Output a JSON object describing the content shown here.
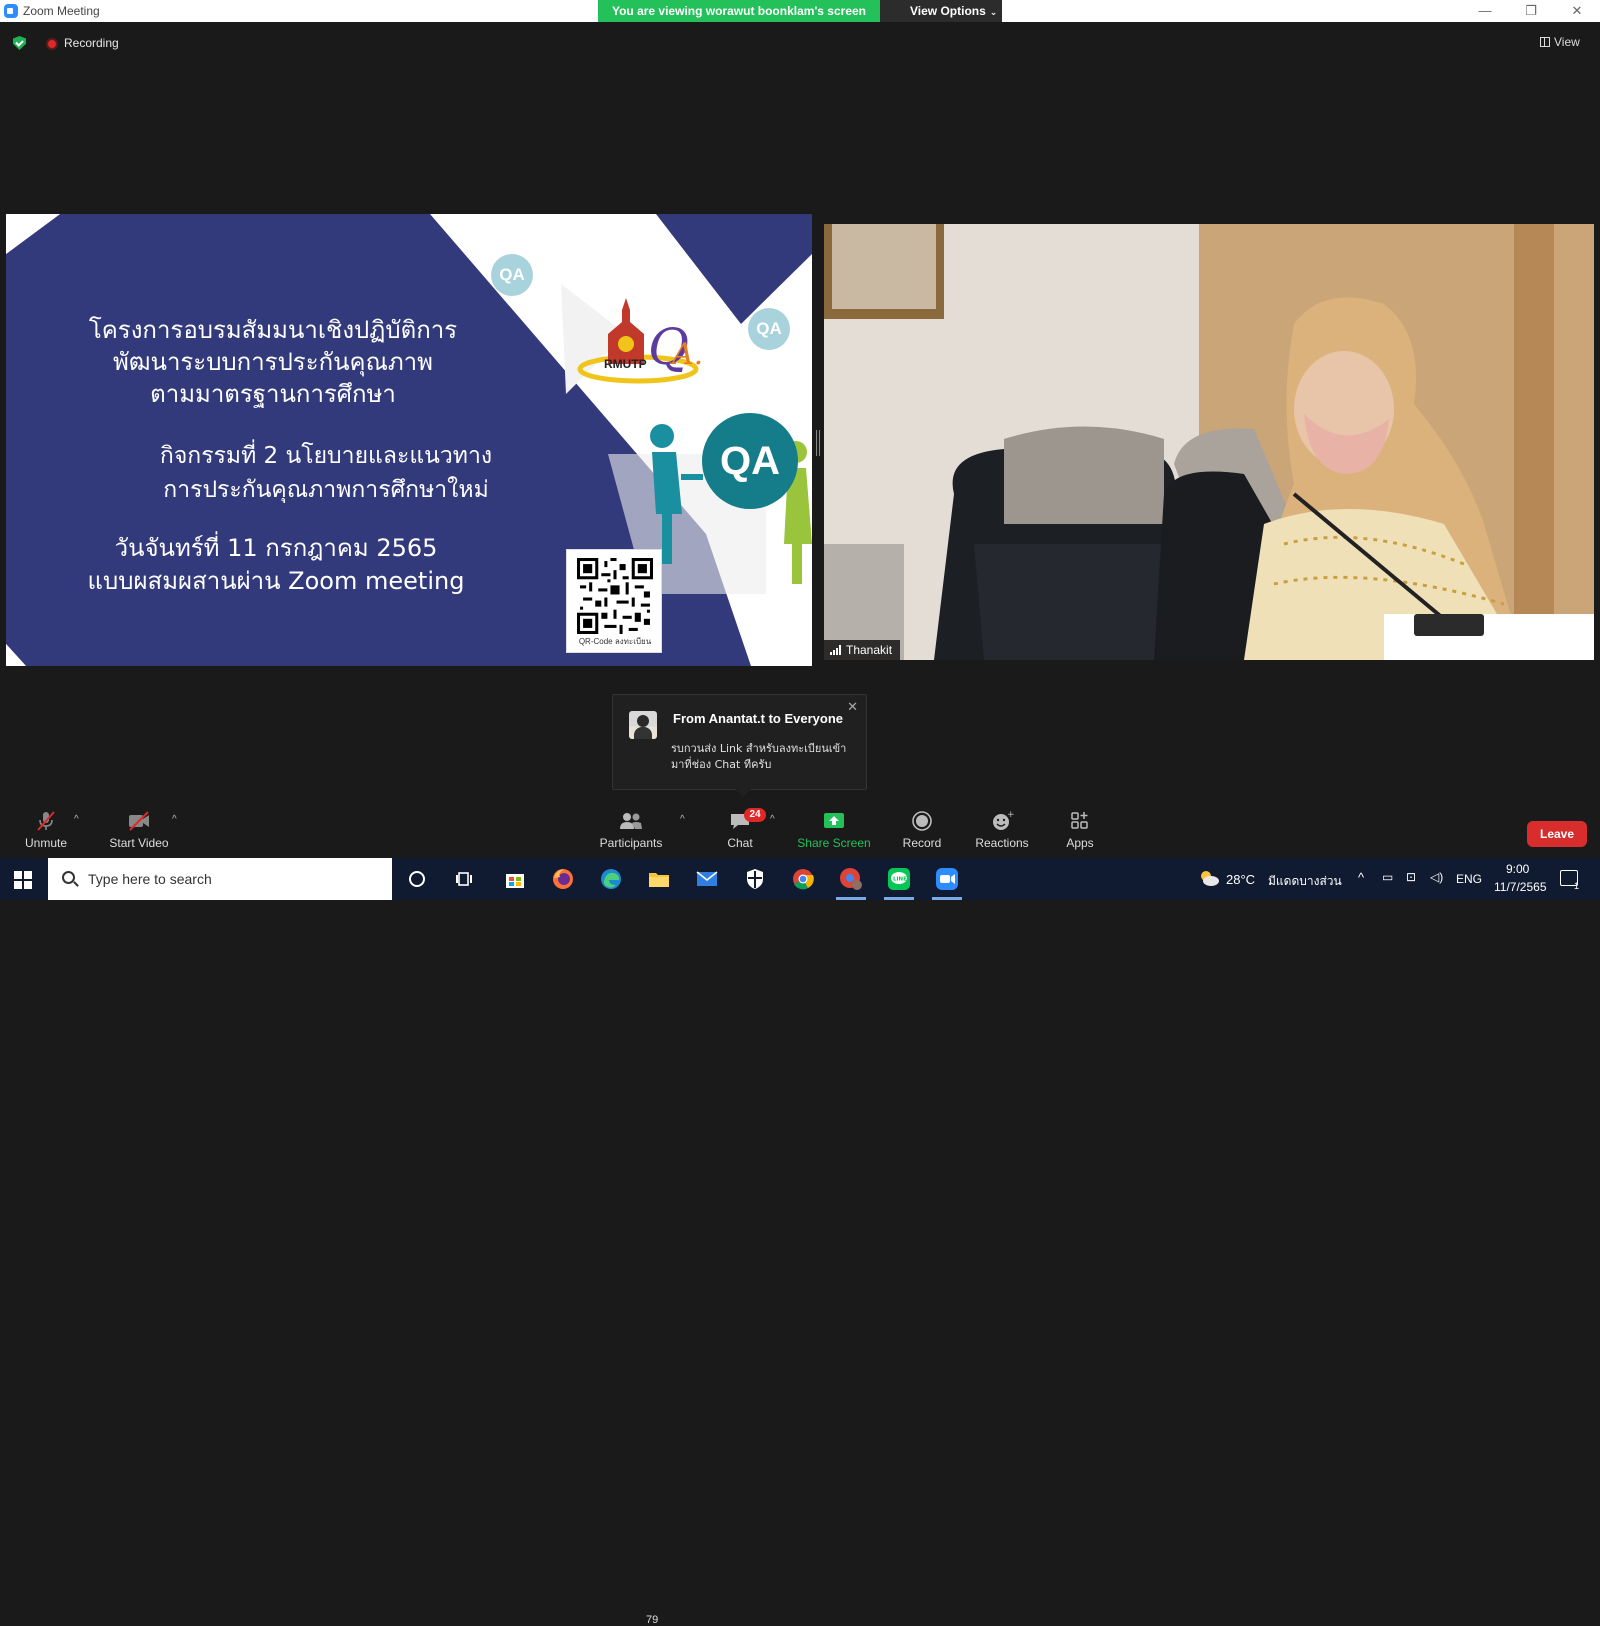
{
  "window": {
    "title": "Zoom Meeting",
    "viewing_banner": "You are viewing worawut boonklam's screen",
    "view_options": "View Options"
  },
  "status": {
    "recording": "Recording",
    "view": "View"
  },
  "slide": {
    "title_lines": [
      "โครงการอบรมสัมมนาเชิงปฏิบัติการ",
      "พัฒนาระบบการประกันคุณภาพ",
      "ตามมาตรฐานการศึกษา"
    ],
    "activity_lines": [
      "กิจกรรมที่ 2 นโยบายและแนวทาง",
      "การประกันคุณภาพการศึกษาใหม่"
    ],
    "date_lines": [
      "วันจันทร์ที่ 11 กรกฎาคม 2565",
      "แบบผสมผสานผ่าน Zoom meeting"
    ],
    "qa_badge": "QA",
    "logo_text": "RMUTP",
    "qr_caption": "QR-Code ลงทะเบียน",
    "colors": {
      "navy": "#333a7c",
      "teal": "#147d89",
      "light_teal": "#a8d3dc"
    }
  },
  "video": {
    "participant_name": "Thanakit"
  },
  "chat_toast": {
    "from": "From Anantat.t to Everyone",
    "message": "รบกวนส่ง Link สำหรับลงทะเบียนเข้ามาที่ช่อง Chat ทีครับ"
  },
  "toolbar": {
    "unmute": "Unmute",
    "start_video": "Start Video",
    "participants": "Participants",
    "participants_count": "79",
    "chat": "Chat",
    "chat_badge": "24",
    "share_screen": "Share Screen",
    "record": "Record",
    "reactions": "Reactions",
    "apps": "Apps",
    "leave": "Leave",
    "share_color": "#24c05a",
    "leave_color": "#d82d2d"
  },
  "taskbar": {
    "search_placeholder": "Type here to search",
    "weather_temp": "28°C",
    "weather_desc": "มีแดดบางส่วน",
    "language": "ENG",
    "time": "9:00",
    "date": "11/7/2565",
    "notification_count": "1",
    "apps": [
      "task-view",
      "microsoft-store",
      "firefox",
      "edge",
      "file-explorer",
      "mail",
      "security",
      "chrome",
      "chrome-profile",
      "line",
      "zoom"
    ]
  }
}
